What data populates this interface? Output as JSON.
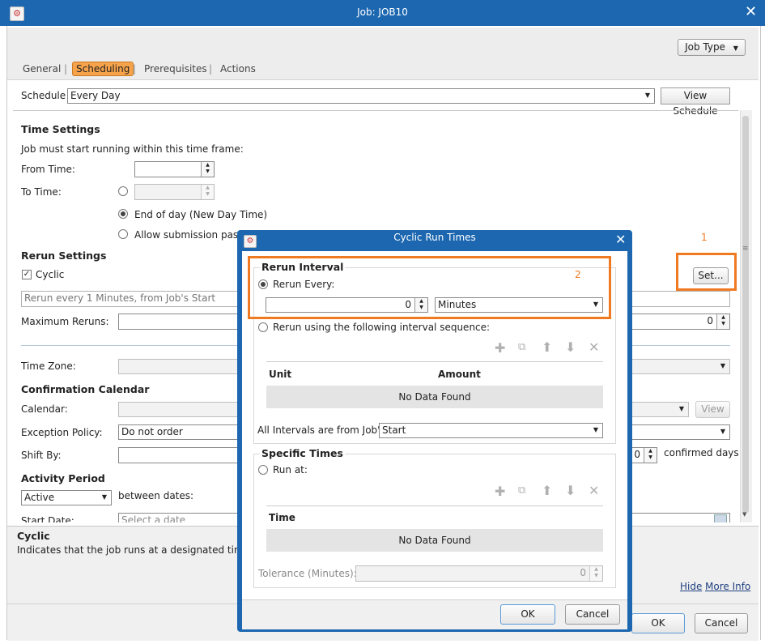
{
  "window": {
    "title": "Job: JOB10",
    "icon": "gear-app-icon"
  },
  "job_type_button": "Job Type",
  "tabs": [
    {
      "label": "General"
    },
    {
      "label": "Scheduling",
      "active": true
    },
    {
      "label": "Prerequisites"
    },
    {
      "label": "Actions"
    }
  ],
  "schedule": {
    "label": "Schedule",
    "value": "Every Day",
    "view_button": "View Schedule"
  },
  "time_settings": {
    "heading": "Time Settings",
    "note": "Job must start running within this time frame:",
    "from_label": "From Time:",
    "to_label": "To Time:",
    "end_of_day_label": "End of day (New Day Time)",
    "allow_label": "Allow submission past n"
  },
  "rerun_settings": {
    "heading": "Rerun Settings",
    "cyclic_label": "Cyclic",
    "cyclic_checked": true,
    "set_button": "Set...",
    "summary": "Rerun every 1 Minutes, from Job's Start",
    "max_reruns_label": "Maximum Reruns:",
    "max_reruns_value": "0"
  },
  "time_zone_label": "Time Zone:",
  "confirmation_calendar": {
    "heading": "Confirmation Calendar",
    "calendar_label": "Calendar:",
    "view_button": "View",
    "exception_label": "Exception Policy:",
    "exception_value": "Do not order",
    "shift_label": "Shift By:",
    "shift_value": "0",
    "confirmed_days": "confirmed days"
  },
  "activity_period": {
    "heading": "Activity Period",
    "select_value": "Active",
    "between_label": "between dates:",
    "start_label": "Start Date:",
    "start_placeholder": "Select a date"
  },
  "help": {
    "title": "Cyclic",
    "text": "Indicates that the job runs at a designated time c",
    "hide_link": "Hide",
    "more_link": "More Info"
  },
  "footer": {
    "ok": "OK",
    "cancel": "Cancel"
  },
  "annotations": {
    "one": "1",
    "two": "2",
    "color": "#f07a22"
  },
  "dialog": {
    "title": "Cyclic Run Times",
    "rerun_interval_heading": "Rerun Interval",
    "rerun_every_label": "Rerun Every:",
    "rerun_every_value": "0",
    "unit_value": "Minutes",
    "sequence_label": "Rerun using the following interval sequence:",
    "table1_headers": [
      "Unit",
      "Amount"
    ],
    "table1_empty": "No Data Found",
    "intervals_from_label": "All Intervals are from Job's",
    "intervals_from_value": "Start",
    "specific_times_heading": "Specific Times",
    "run_at_label": "Run at:",
    "table2_header": "Time",
    "table2_empty": "No Data Found",
    "tolerance_label": "Tolerance (Minutes):",
    "tolerance_value": "0",
    "ok": "OK",
    "cancel": "Cancel"
  },
  "colors": {
    "titlebar": "#1c67b0",
    "active_tab": "#f6a34c",
    "annotation": "#f07a22"
  }
}
